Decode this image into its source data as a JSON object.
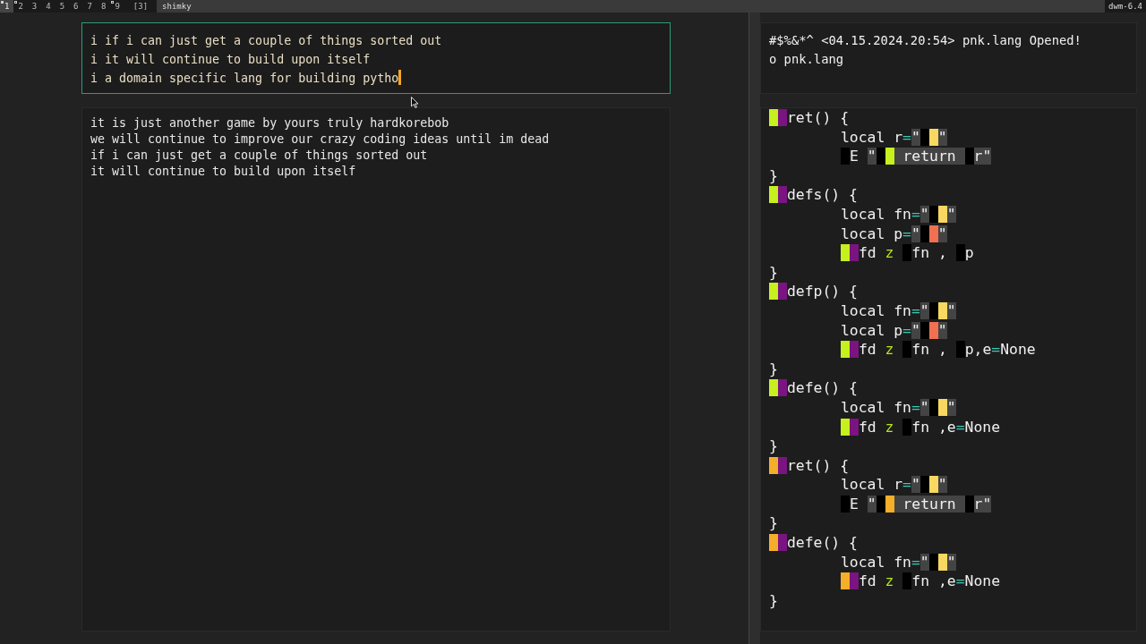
{
  "bar": {
    "tags": [
      {
        "label": "1",
        "selected": true,
        "occupied": true
      },
      {
        "label": "2",
        "selected": false,
        "occupied": true
      },
      {
        "label": "3",
        "selected": false,
        "occupied": false
      },
      {
        "label": "4",
        "selected": false,
        "occupied": false
      },
      {
        "label": "5",
        "selected": false,
        "occupied": false
      },
      {
        "label": "6",
        "selected": false,
        "occupied": false
      },
      {
        "label": "7",
        "selected": false,
        "occupied": false
      },
      {
        "label": "8",
        "selected": false,
        "occupied": false
      },
      {
        "label": "9",
        "selected": false,
        "occupied": true
      }
    ],
    "layout": "[3]",
    "title": "shimky",
    "status": "dwm-6.4"
  },
  "input_box": {
    "lines": [
      "i if i can just get a couple of things sorted out",
      "i it will continue to build upon itself",
      "i a domain specific lang for building pytho"
    ]
  },
  "output_panel": {
    "lines": [
      "it is just another game by yours truly hardkorebob",
      "we will continue to improve our crazy coding ideas until im dead",
      "if i can just get a couple of things sorted out",
      "it will continue to build upon itself"
    ]
  },
  "log_panel": {
    "lines": [
      "#$%&*^ <04.15.2024.20:54> pnk.lang Opened!",
      "o pnk.lang"
    ]
  },
  "code_panel": {
    "lines": [
      {
        "indented": false,
        "segs": [
          {
            "kind": "block",
            "color": "#c6f01e"
          },
          {
            "kind": "block",
            "color": "#7a1480"
          },
          {
            "kind": "text",
            "text": "ret() {"
          }
        ]
      },
      {
        "indented": true,
        "segs": [
          {
            "kind": "text",
            "text": "local r"
          },
          {
            "kind": "operator",
            "text": "="
          },
          {
            "kind": "string",
            "text": "\""
          },
          {
            "kind": "block",
            "color": "#000000"
          },
          {
            "kind": "block",
            "color": "#f8d860"
          },
          {
            "kind": "string",
            "text": "\""
          }
        ]
      },
      {
        "indented": true,
        "segs": [
          {
            "kind": "block",
            "color": "#000000"
          },
          {
            "kind": "text",
            "text": "E "
          },
          {
            "kind": "string",
            "text": "\""
          },
          {
            "kind": "block",
            "color": "#000000"
          },
          {
            "kind": "block",
            "color": "#c6f01e"
          },
          {
            "kind": "string",
            "text": " return "
          },
          {
            "kind": "block",
            "color": "#000000"
          },
          {
            "kind": "string",
            "text": "r\""
          }
        ]
      },
      {
        "indented": false,
        "segs": [
          {
            "kind": "text",
            "text": "}"
          }
        ]
      },
      {
        "indented": false,
        "segs": [
          {
            "kind": "block",
            "color": "#c6f01e"
          },
          {
            "kind": "block",
            "color": "#7a1480"
          },
          {
            "kind": "text",
            "text": "defs() {"
          }
        ]
      },
      {
        "indented": true,
        "segs": [
          {
            "kind": "text",
            "text": "local fn"
          },
          {
            "kind": "operator",
            "text": "="
          },
          {
            "kind": "string",
            "text": "\""
          },
          {
            "kind": "block",
            "color": "#000000"
          },
          {
            "kind": "block",
            "color": "#f8d860"
          },
          {
            "kind": "string",
            "text": "\""
          }
        ]
      },
      {
        "indented": true,
        "segs": [
          {
            "kind": "text",
            "text": "local p"
          },
          {
            "kind": "operator",
            "text": "="
          },
          {
            "kind": "string",
            "text": "\""
          },
          {
            "kind": "block",
            "color": "#000000"
          },
          {
            "kind": "block",
            "color": "#f07050"
          },
          {
            "kind": "string",
            "text": "\""
          }
        ]
      },
      {
        "indented": true,
        "segs": [
          {
            "kind": "block",
            "color": "#c6f01e"
          },
          {
            "kind": "block",
            "color": "#7a1480"
          },
          {
            "kind": "text",
            "text": "fd "
          },
          {
            "kind": "keyword",
            "text": "z "
          },
          {
            "kind": "block",
            "color": "#000000"
          },
          {
            "kind": "text",
            "text": "fn , "
          },
          {
            "kind": "block",
            "color": "#000000"
          },
          {
            "kind": "text",
            "text": "p"
          }
        ]
      },
      {
        "indented": false,
        "segs": [
          {
            "kind": "text",
            "text": "}"
          }
        ]
      },
      {
        "indented": false,
        "segs": [
          {
            "kind": "block",
            "color": "#c6f01e"
          },
          {
            "kind": "block",
            "color": "#7a1480"
          },
          {
            "kind": "text",
            "text": "defp() {"
          }
        ]
      },
      {
        "indented": true,
        "segs": [
          {
            "kind": "text",
            "text": "local fn"
          },
          {
            "kind": "operator",
            "text": "="
          },
          {
            "kind": "string",
            "text": "\""
          },
          {
            "kind": "block",
            "color": "#000000"
          },
          {
            "kind": "block",
            "color": "#f8d860"
          },
          {
            "kind": "string",
            "text": "\""
          }
        ]
      },
      {
        "indented": true,
        "segs": [
          {
            "kind": "text",
            "text": "local p"
          },
          {
            "kind": "operator",
            "text": "="
          },
          {
            "kind": "string",
            "text": "\""
          },
          {
            "kind": "block",
            "color": "#000000"
          },
          {
            "kind": "block",
            "color": "#f07050"
          },
          {
            "kind": "string",
            "text": "\""
          }
        ]
      },
      {
        "indented": true,
        "segs": [
          {
            "kind": "block",
            "color": "#c6f01e"
          },
          {
            "kind": "block",
            "color": "#7a1480"
          },
          {
            "kind": "text",
            "text": "fd "
          },
          {
            "kind": "keyword",
            "text": "z "
          },
          {
            "kind": "block",
            "color": "#000000"
          },
          {
            "kind": "text",
            "text": "fn , "
          },
          {
            "kind": "block",
            "color": "#000000"
          },
          {
            "kind": "text",
            "text": "p,e"
          },
          {
            "kind": "operator",
            "text": "="
          },
          {
            "kind": "text",
            "text": "None"
          }
        ]
      },
      {
        "indented": false,
        "segs": [
          {
            "kind": "text",
            "text": "}"
          }
        ]
      },
      {
        "indented": false,
        "segs": [
          {
            "kind": "block",
            "color": "#c6f01e"
          },
          {
            "kind": "block",
            "color": "#7a1480"
          },
          {
            "kind": "text",
            "text": "defe() {"
          }
        ]
      },
      {
        "indented": true,
        "segs": [
          {
            "kind": "text",
            "text": "local fn"
          },
          {
            "kind": "operator",
            "text": "="
          },
          {
            "kind": "string",
            "text": "\""
          },
          {
            "kind": "block",
            "color": "#000000"
          },
          {
            "kind": "block",
            "color": "#f8d860"
          },
          {
            "kind": "string",
            "text": "\""
          }
        ]
      },
      {
        "indented": true,
        "segs": [
          {
            "kind": "block",
            "color": "#c6f01e"
          },
          {
            "kind": "block",
            "color": "#7a1480"
          },
          {
            "kind": "text",
            "text": "fd "
          },
          {
            "kind": "keyword",
            "text": "z "
          },
          {
            "kind": "block",
            "color": "#000000"
          },
          {
            "kind": "text",
            "text": "fn ,e"
          },
          {
            "kind": "operator",
            "text": "="
          },
          {
            "kind": "text",
            "text": "None"
          }
        ]
      },
      {
        "indented": false,
        "segs": [
          {
            "kind": "text",
            "text": "}"
          }
        ]
      },
      {
        "indented": false,
        "segs": [
          {
            "kind": "block",
            "color": "#f5ae2a"
          },
          {
            "kind": "block",
            "color": "#7a1480"
          },
          {
            "kind": "text",
            "text": "ret() {"
          }
        ]
      },
      {
        "indented": true,
        "segs": [
          {
            "kind": "text",
            "text": "local r"
          },
          {
            "kind": "operator",
            "text": "="
          },
          {
            "kind": "string",
            "text": "\""
          },
          {
            "kind": "block",
            "color": "#000000"
          },
          {
            "kind": "block",
            "color": "#f8d860"
          },
          {
            "kind": "string",
            "text": "\""
          }
        ]
      },
      {
        "indented": true,
        "segs": [
          {
            "kind": "block",
            "color": "#000000"
          },
          {
            "kind": "text",
            "text": "E "
          },
          {
            "kind": "string",
            "text": "\""
          },
          {
            "kind": "block",
            "color": "#000000"
          },
          {
            "kind": "block",
            "color": "#f5ae2a"
          },
          {
            "kind": "string",
            "text": " return "
          },
          {
            "kind": "block",
            "color": "#000000"
          },
          {
            "kind": "string",
            "text": "r\""
          }
        ]
      },
      {
        "indented": false,
        "segs": [
          {
            "kind": "text",
            "text": "}"
          }
        ]
      },
      {
        "indented": false,
        "segs": [
          {
            "kind": "block",
            "color": "#f5ae2a"
          },
          {
            "kind": "block",
            "color": "#7a1480"
          },
          {
            "kind": "text",
            "text": "defe() {"
          }
        ]
      },
      {
        "indented": true,
        "segs": [
          {
            "kind": "text",
            "text": "local fn"
          },
          {
            "kind": "operator",
            "text": "="
          },
          {
            "kind": "string",
            "text": "\""
          },
          {
            "kind": "block",
            "color": "#000000"
          },
          {
            "kind": "block",
            "color": "#f8d860"
          },
          {
            "kind": "string",
            "text": "\""
          }
        ]
      },
      {
        "indented": true,
        "segs": [
          {
            "kind": "block",
            "color": "#f5ae2a"
          },
          {
            "kind": "block",
            "color": "#7a1480"
          },
          {
            "kind": "text",
            "text": "fd "
          },
          {
            "kind": "keyword",
            "text": "z "
          },
          {
            "kind": "block",
            "color": "#000000"
          },
          {
            "kind": "text",
            "text": "fn ,e"
          },
          {
            "kind": "operator",
            "text": "="
          },
          {
            "kind": "text",
            "text": "None"
          }
        ]
      },
      {
        "indented": false,
        "segs": [
          {
            "kind": "text",
            "text": "}"
          }
        ]
      }
    ]
  }
}
